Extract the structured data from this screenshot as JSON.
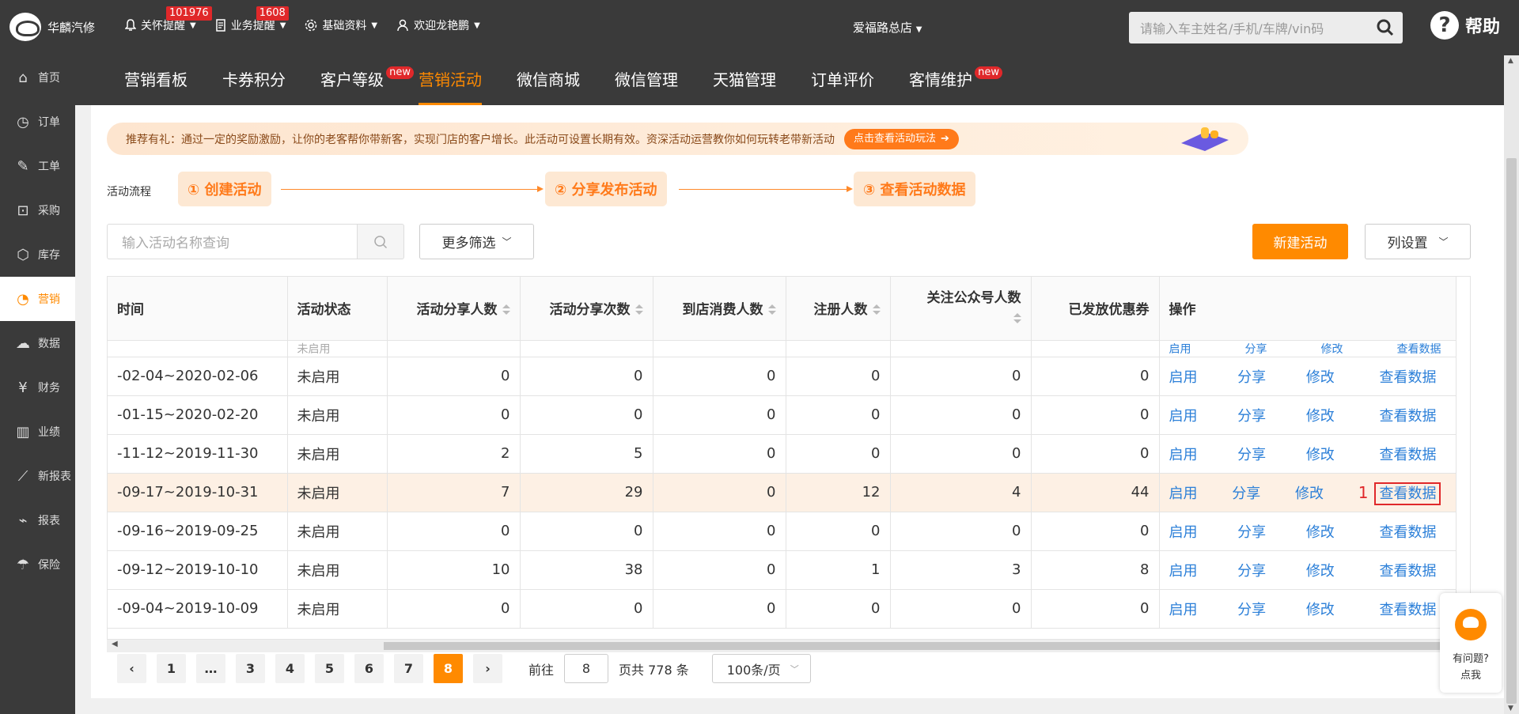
{
  "topbar": {
    "brand": "华麟汽修",
    "nav": [
      {
        "label": "关怀提醒",
        "badge": "101976",
        "icon": "bell-icon"
      },
      {
        "label": "业务提醒",
        "badge": "1608",
        "icon": "doc-icon"
      },
      {
        "label": "基础资料",
        "badge": "",
        "icon": "gear-icon"
      },
      {
        "label": "欢迎龙艳鹏",
        "badge": "",
        "icon": "user-icon"
      }
    ],
    "store": "爱福路总店",
    "search_placeholder": "请输入车主姓名/手机/车牌/vin码",
    "help": "帮助"
  },
  "sidebar": {
    "items": [
      {
        "label": "首页",
        "icon": "home-icon"
      },
      {
        "label": "订单",
        "icon": "clock-icon"
      },
      {
        "label": "工单",
        "icon": "wrench-icon"
      },
      {
        "label": "采购",
        "icon": "cart-icon"
      },
      {
        "label": "库存",
        "icon": "box-icon"
      },
      {
        "label": "营销",
        "icon": "pie-icon"
      },
      {
        "label": "数据",
        "icon": "cloud-icon"
      },
      {
        "label": "财务",
        "icon": "yen-icon"
      },
      {
        "label": "业绩",
        "icon": "bar-icon"
      },
      {
        "label": "新报表",
        "icon": "linechart-icon"
      },
      {
        "label": "报表",
        "icon": "chart-icon"
      },
      {
        "label": "保险",
        "icon": "umbrella-icon"
      }
    ],
    "active_index": 5
  },
  "menu": {
    "items": [
      {
        "label": "营销看板",
        "new": ""
      },
      {
        "label": "卡券积分",
        "new": ""
      },
      {
        "label": "客户等级",
        "new": "new"
      },
      {
        "label": "营销活动",
        "new": ""
      },
      {
        "label": "微信商城",
        "new": ""
      },
      {
        "label": "微信管理",
        "new": ""
      },
      {
        "label": "天猫管理",
        "new": ""
      },
      {
        "label": "订单评价",
        "new": ""
      },
      {
        "label": "客情维护",
        "new": "new"
      }
    ],
    "active_index": 3
  },
  "banner": {
    "text": "推荐有礼：通过一定的奖励激励，让你的老客帮你带新客，实现门店的客户增长。此活动可设置长期有效。资深活动运营教你如何玩转老带新活动",
    "button": "点击查看活动玩法"
  },
  "flow": {
    "label": "活动流程",
    "steps": [
      "① 创建活动",
      "② 分享发布活动",
      "③ 查看活动数据"
    ]
  },
  "toolbar": {
    "search_placeholder": "输入活动名称查询",
    "more_filter": "更多筛选",
    "new_activity": "新建活动",
    "column_settings": "列设置"
  },
  "table": {
    "columns": [
      "时间",
      "活动状态",
      "活动分享人数",
      "活动分享次数",
      "到店消费人数",
      "注册人数",
      "关注公众号人数",
      "已发放优惠券",
      "操作"
    ],
    "partial_row": {
      "status": "未启用",
      "ops": [
        "启用",
        "分享",
        "修改",
        "查看数据"
      ]
    },
    "rows": [
      {
        "time": "-02-04~2020-02-06",
        "status": "未启用",
        "share_people": "0",
        "share_times": "0",
        "visit": "0",
        "register": "0",
        "follow": "0",
        "coupons": "0"
      },
      {
        "time": "-01-15~2020-02-20",
        "status": "未启用",
        "share_people": "0",
        "share_times": "0",
        "visit": "0",
        "register": "0",
        "follow": "0",
        "coupons": "0"
      },
      {
        "time": "-11-12~2019-11-30",
        "status": "未启用",
        "share_people": "2",
        "share_times": "5",
        "visit": "0",
        "register": "0",
        "follow": "0",
        "coupons": "0"
      },
      {
        "time": "-09-17~2019-10-31",
        "status": "未启用",
        "share_people": "7",
        "share_times": "29",
        "visit": "0",
        "register": "12",
        "follow": "4",
        "coupons": "44"
      },
      {
        "time": "-09-16~2019-09-25",
        "status": "未启用",
        "share_people": "0",
        "share_times": "0",
        "visit": "0",
        "register": "0",
        "follow": "0",
        "coupons": "0"
      },
      {
        "time": "-09-12~2019-10-10",
        "status": "未启用",
        "share_people": "10",
        "share_times": "38",
        "visit": "0",
        "register": "1",
        "follow": "3",
        "coupons": "8"
      },
      {
        "time": "-09-04~2019-10-09",
        "status": "未启用",
        "share_people": "0",
        "share_times": "0",
        "visit": "0",
        "register": "0",
        "follow": "0",
        "coupons": "0"
      }
    ],
    "ops": [
      "启用",
      "分享",
      "修改",
      "查看数据"
    ],
    "highlight_row": 3,
    "highlight_marker": "1"
  },
  "pagination": {
    "pages": [
      "1",
      "…",
      "3",
      "4",
      "5",
      "6",
      "7",
      "8"
    ],
    "active": "8",
    "goto_label": "前往",
    "goto_value": "8",
    "total_text": "页共 778 条",
    "page_size": "100条/页"
  },
  "float_help": {
    "line1": "有问题?",
    "line2": "点我"
  }
}
